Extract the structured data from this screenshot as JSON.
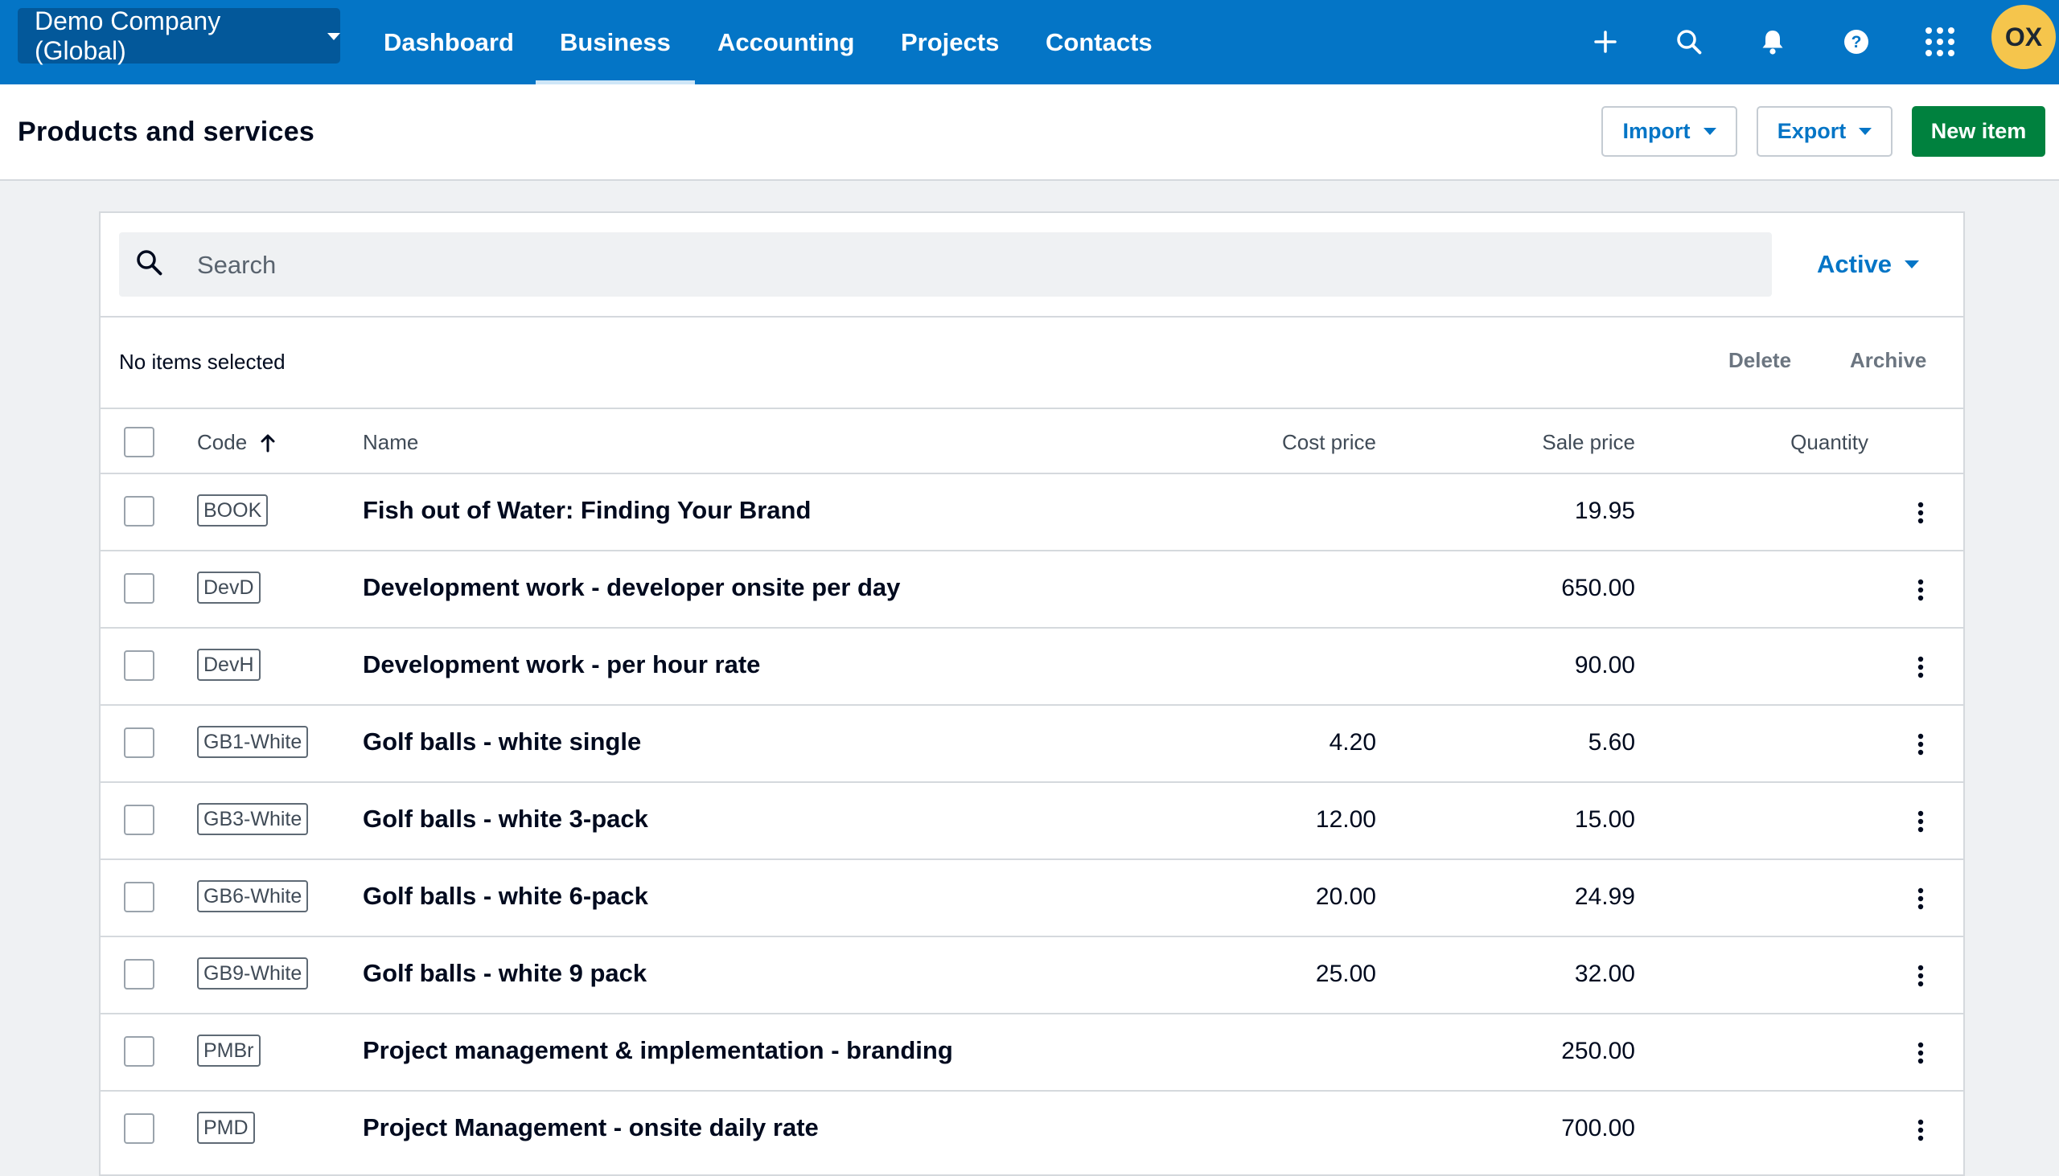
{
  "topbar": {
    "org_name": "Demo Company (Global)",
    "nav": [
      "Dashboard",
      "Business",
      "Accounting",
      "Projects",
      "Contacts"
    ],
    "active_nav": "Business",
    "avatar_initials": "OX",
    "icons": [
      "plus-icon",
      "search-icon",
      "bell-icon",
      "help-icon",
      "apps-grid-icon"
    ]
  },
  "header": {
    "title": "Products and services",
    "import_label": "Import",
    "export_label": "Export",
    "new_item_label": "New item"
  },
  "toolbar": {
    "search_placeholder": "Search",
    "status_filter": "Active",
    "selection_text": "No items selected",
    "delete_label": "Delete",
    "archive_label": "Archive"
  },
  "table": {
    "columns": {
      "code": "Code",
      "name": "Name",
      "cost": "Cost price",
      "sale": "Sale price",
      "quantity": "Quantity"
    },
    "sort": "code-ascending",
    "rows": [
      {
        "code": "BOOK",
        "name": "Fish out of Water: Finding Your Brand",
        "cost": "",
        "sale": "19.95"
      },
      {
        "code": "DevD",
        "name": "Development work - developer onsite per day",
        "cost": "",
        "sale": "650.00"
      },
      {
        "code": "DevH",
        "name": "Development work - per hour rate",
        "cost": "",
        "sale": "90.00"
      },
      {
        "code": "GB1-White",
        "name": "Golf balls - white single",
        "cost": "4.20",
        "sale": "5.60"
      },
      {
        "code": "GB3-White",
        "name": "Golf balls - white 3-pack",
        "cost": "12.00",
        "sale": "15.00"
      },
      {
        "code": "GB6-White",
        "name": "Golf balls - white 6-pack",
        "cost": "20.00",
        "sale": "24.99"
      },
      {
        "code": "GB9-White",
        "name": "Golf balls - white 9 pack",
        "cost": "25.00",
        "sale": "32.00"
      },
      {
        "code": "PMBr",
        "name": "Project management & implementation - branding",
        "cost": "",
        "sale": "250.00"
      },
      {
        "code": "PMD",
        "name": "Project Management - onsite daily rate",
        "cost": "",
        "sale": "700.00"
      }
    ]
  },
  "colors": {
    "topbar": "#0475c6",
    "org_switch": "#03589a",
    "primary_link": "#0475c6",
    "new_button": "#00813e",
    "avatar": "#f5c54c",
    "page_bg": "#eff1f3"
  }
}
